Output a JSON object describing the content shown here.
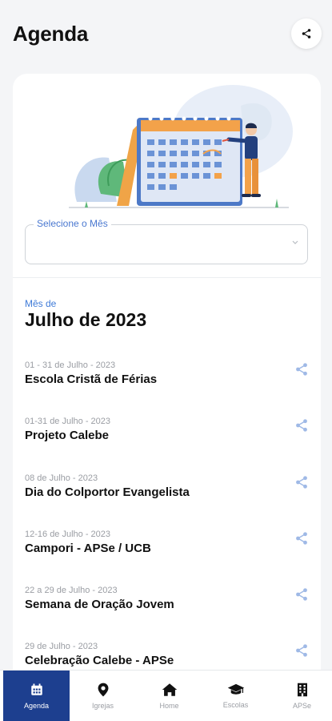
{
  "header": {
    "title": "Agenda",
    "share_icon": "share-icon"
  },
  "month_select": {
    "label": "Selecione o Mês",
    "value": ""
  },
  "month": {
    "caption": "Mês de",
    "name": "Julho de 2023"
  },
  "events": [
    {
      "date": "01 - 31 de Julho - 2023",
      "name": "Escola Cristã de Férias"
    },
    {
      "date": "01-31 de Julho - 2023",
      "name": "Projeto Calebe"
    },
    {
      "date": "08 de Julho - 2023",
      "name": "Dia do Colportor Evangelista"
    },
    {
      "date": "12-16 de Julho - 2023",
      "name": "Campori - APSe / UCB"
    },
    {
      "date": "22 a 29 de Julho - 2023",
      "name": "Semana de Oração Jovem"
    },
    {
      "date": "29 de Julho - 2023",
      "name": "Celebração Calebe - APSe"
    }
  ],
  "nav": {
    "items": [
      {
        "label": "Agenda",
        "icon": "calendar-icon",
        "active": true
      },
      {
        "label": "Igrejas",
        "icon": "location-pin-icon",
        "active": false
      },
      {
        "label": "Home",
        "icon": "home-icon",
        "active": false
      },
      {
        "label": "Escolas",
        "icon": "graduation-cap-icon",
        "active": false
      },
      {
        "label": "APSe",
        "icon": "building-icon",
        "active": false
      }
    ]
  },
  "colors": {
    "accent": "#1d3f8f",
    "link_blue": "#3f7bd8",
    "share_blue": "#9fb9e6",
    "orange": "#f3a24a"
  }
}
